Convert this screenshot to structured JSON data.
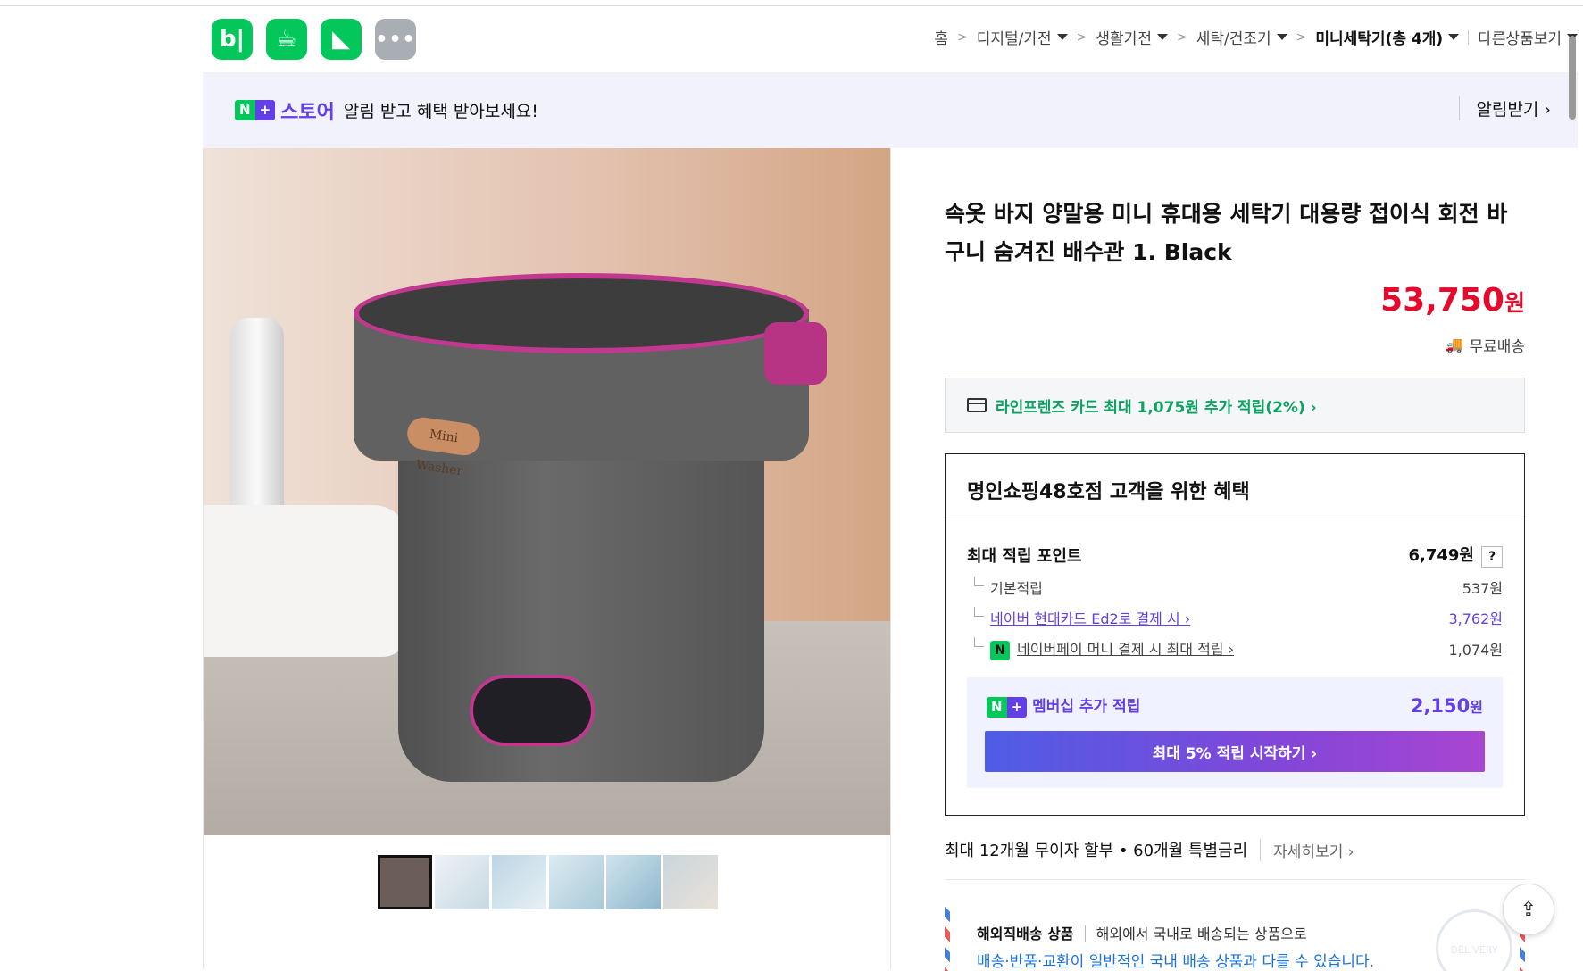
{
  "apps": [
    {
      "label": "b|",
      "icon": "blog-icon"
    },
    {
      "label": "☕",
      "icon": "cafe-icon"
    },
    {
      "label": "◣",
      "icon": "bookmark-icon"
    },
    {
      "label": "•••",
      "icon": "more-icon"
    }
  ],
  "breadcrumb": {
    "home": "홈",
    "cat1": "디지털/가전",
    "cat2": "생활가전",
    "cat3": "세탁/건조기",
    "cat4": "미니세탁기(총 4개)",
    "more": "다른상품보기"
  },
  "banner": {
    "badge_n": "N",
    "badge_plus": "+",
    "store": "스토어",
    "message": "알림 받고 혜택 받아보세요!",
    "alert_button": "알림받기 ›"
  },
  "product": {
    "image_tag": "Mini Washer",
    "title": "속옷 바지 양말용 미니 휴대용 세탁기 대용량 접이식 회전 바구니 숨겨진 배수관 1. Black",
    "price": "53,750",
    "currency": "원",
    "shipping": "무료배송",
    "card_offer": "라인프렌즈 카드 최대 1,075원 추가 적립(2%) ›"
  },
  "benefit": {
    "header": "명인쇼핑48호점 고객을 위한 혜택",
    "max_points_label": "최대 적립 포인트",
    "max_points_value": "6,749원",
    "help": "?",
    "basic_label": "기본적립",
    "basic_value": "537원",
    "hyundai_label": "네이버 현대카드 Ed2로 결제 시 ›",
    "hyundai_value": "3,762원",
    "npay_badge": "N",
    "npay_label": "네이버페이 머니 결제 시 최대 적립 ›",
    "npay_value": "1,074원",
    "member_label": "멤버십 추가 적립",
    "member_value": "2,150",
    "member_won": "원",
    "cta": "최대 5% 적립 시작하기 ›"
  },
  "installment": {
    "text": "최대 12개월 무이자 할부 • 60개월 특별금리",
    "more": "자세히보기 ›"
  },
  "overseas": {
    "title": "해외직배송 상품",
    "line1": "해외에서 국내로 배송되는 상품으로",
    "line2": "배송·반품·교환이 일반적인 국내 배송 상품과 다를 수 있습니다.",
    "stamp": "DELIVERY"
  },
  "share_icon": "share-icon",
  "colors": {
    "naver_green": "#03c75a",
    "store_purple": "#6340e6",
    "price_red": "#e5092b"
  }
}
